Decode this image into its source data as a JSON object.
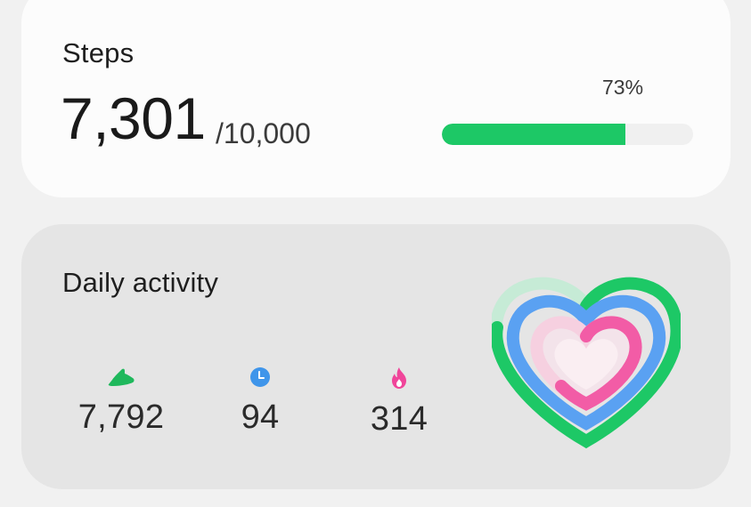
{
  "steps_card": {
    "title": "Steps",
    "count": "7,301",
    "goal": "/10,000",
    "progress_label": "73%",
    "progress_fraction": 0.73,
    "accent_color": "#1dc866"
  },
  "activity_card": {
    "title": "Daily activity",
    "stats": [
      {
        "icon": "shoe-icon",
        "value": "7,792",
        "color": "#1fb85c"
      },
      {
        "icon": "clock-icon",
        "value": "94",
        "color": "#3f95ea"
      },
      {
        "icon": "flame-icon",
        "value": "314",
        "color": "#f0459a"
      }
    ],
    "rings": {
      "steps_color": "#1dc866",
      "time_color": "#5aa1f2",
      "calories_color": "#f25ca6"
    }
  }
}
